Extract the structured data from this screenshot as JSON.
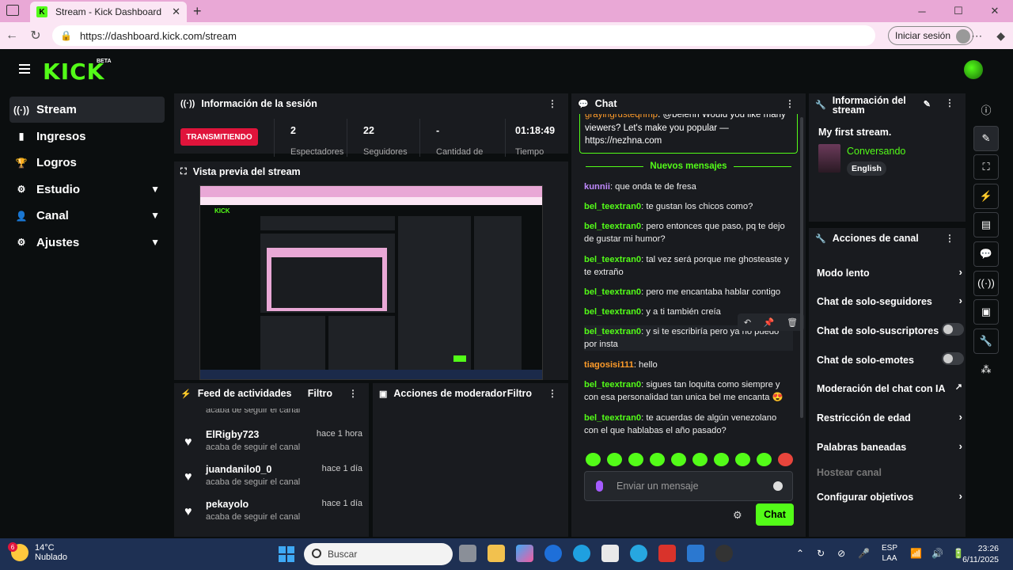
{
  "browser": {
    "tab_title": "Stream - Kick Dashboard",
    "url": "https://dashboard.kick.com/stream",
    "signin_label": "Iniciar sesión"
  },
  "app": {
    "logo": "KICK",
    "beta": "BETA"
  },
  "sidebar": {
    "items": [
      {
        "label": "Stream",
        "icon": "broadcast-icon",
        "active": true
      },
      {
        "label": "Ingresos",
        "icon": "chart-icon"
      },
      {
        "label": "Logros",
        "icon": "trophy-icon"
      },
      {
        "label": "Estudio",
        "icon": "gear-icon",
        "expandable": true
      },
      {
        "label": "Canal",
        "icon": "user-icon",
        "expandable": true
      },
      {
        "label": "Ajustes",
        "icon": "settings-icon",
        "expandable": true
      }
    ]
  },
  "session": {
    "title": "Información de la sesión",
    "status": "TRANSMITIENDO",
    "stats": [
      {
        "value": "2",
        "label": "Espectadores"
      },
      {
        "value": "22",
        "label": "Seguidores"
      },
      {
        "value": "-",
        "label": "Cantidad de"
      },
      {
        "value": "01:18:49",
        "label": "Tiempo"
      }
    ]
  },
  "preview": {
    "title": "Vista previa del stream",
    "mini_logo": "KICK"
  },
  "feed": {
    "title": "Feed de actividades",
    "filter": "Filtro",
    "partial_action": "acaba de seguir el canal",
    "items": [
      {
        "name": "ElRigby723",
        "action": "acaba de seguir el canal",
        "time": "hace 1 hora"
      },
      {
        "name": "juandanilo0_0",
        "action": "acaba de seguir el canal",
        "time": "hace 1 día"
      },
      {
        "name": "pekayolo",
        "action": "acaba de seguir el canal",
        "time": "hace 1 día"
      }
    ]
  },
  "mod": {
    "title": "Acciones de moderador",
    "filter": "Filtro"
  },
  "chat": {
    "title": "Chat",
    "pinned_user": "grayingrusteqnmp",
    "pinned_text": ": @belenn Would you like many viewers? Let's make you popular — https://nezhna.com",
    "new_messages": "Nuevos mensajes",
    "messages": [
      {
        "user": "kunnii",
        "text": ": que onda te de fresa",
        "color": "purple"
      },
      {
        "user": "bel_teextran0",
        "text": ": te gustan los chicos como?",
        "color": "green"
      },
      {
        "user": "bel_teextran0",
        "text": ": pero entonces que paso, pq te dejo de gustar mi humor?",
        "color": "green"
      },
      {
        "user": "bel_teextran0",
        "text": ": tal vez será porque me ghosteaste y te extraño",
        "color": "green"
      },
      {
        "user": "bel_teextran0",
        "text": ": pero me encantaba hablar contigo",
        "color": "green"
      },
      {
        "user": "bel_teextran0",
        "text": ": y a ti también creía",
        "color": "green"
      },
      {
        "user": "bel_teextran0",
        "text": ": y si te escribiría pero ya no puedo por insta",
        "color": "green"
      },
      {
        "user": "tiagosisi111",
        "text": ": hello",
        "color": "orange"
      },
      {
        "user": "bel_teextran0",
        "text": ": sigues tan loquita como siempre y con esa personalidad tan unica bel me encanta 😍",
        "color": "green"
      },
      {
        "user": "bel_teextran0",
        "text": ": te acuerdas de algún venezolano con el que hablabas el año pasado?",
        "color": "green"
      }
    ],
    "input_placeholder": "Enviar un mensaje",
    "send_label": "Chat"
  },
  "stream_info": {
    "title": "Información del stream",
    "stream_title": "My first stream.",
    "category": "Conversando",
    "language": "English"
  },
  "channel_actions": {
    "title": "Acciones de canal",
    "items": [
      {
        "label": "Modo lento",
        "control": "arrow"
      },
      {
        "label": "Chat de solo-seguidores",
        "control": "arrow"
      },
      {
        "label": "Chat de solo-suscriptores",
        "control": "toggle"
      },
      {
        "label": "Chat de solo-emotes",
        "control": "toggle"
      },
      {
        "label": "Moderación del chat con IA",
        "control": "external"
      },
      {
        "label": "Restricción de edad",
        "control": "arrow"
      },
      {
        "label": "Palabras baneadas",
        "control": "arrow"
      },
      {
        "label": "Hostear canal",
        "control": "none",
        "disabled": true
      },
      {
        "label": "Configurar objetivos",
        "control": "arrow"
      }
    ]
  },
  "taskbar": {
    "temp": "14°C",
    "weather": "Nublado",
    "badge": "6",
    "search": "Buscar",
    "lang1": "ESP",
    "lang2": "LAA",
    "time": "23:26",
    "date": "6/11/2025"
  }
}
